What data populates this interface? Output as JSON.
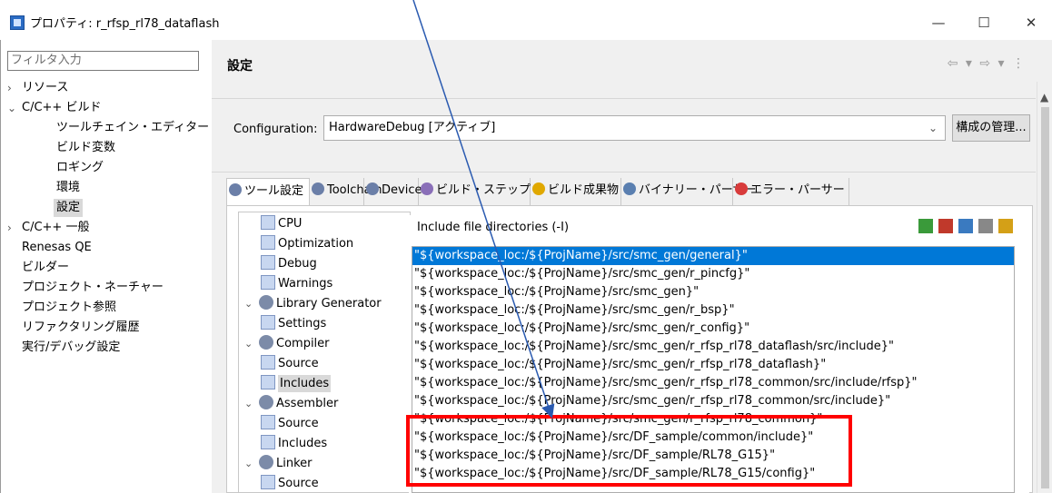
{
  "window": {
    "title": "プロパティ: r_rfsp_rl78_dataflash",
    "minimize": "—",
    "maximize": "☐",
    "close": "✕"
  },
  "sidebar": {
    "filter_placeholder": "フィルタ入力",
    "items": [
      {
        "label": "リソース",
        "expander": "›",
        "indent": 0
      },
      {
        "label": "C/C++ ビルド",
        "expander": "⌄",
        "indent": 0
      },
      {
        "label": "ツールチェイン・エディター",
        "expander": "",
        "indent": 1
      },
      {
        "label": "ビルド変数",
        "expander": "",
        "indent": 1
      },
      {
        "label": "ロギング",
        "expander": "",
        "indent": 1
      },
      {
        "label": "環境",
        "expander": "",
        "indent": 1
      },
      {
        "label": "設定",
        "expander": "",
        "indent": 1,
        "selected": true
      },
      {
        "label": "C/C++ 一般",
        "expander": "›",
        "indent": 0
      },
      {
        "label": "Renesas QE",
        "expander": "",
        "indent": 0
      },
      {
        "label": "ビルダー",
        "expander": "",
        "indent": 0
      },
      {
        "label": "プロジェクト・ネーチャー",
        "expander": "",
        "indent": 0
      },
      {
        "label": "プロジェクト参照",
        "expander": "",
        "indent": 0
      },
      {
        "label": "リファクタリング履歴",
        "expander": "",
        "indent": 0
      },
      {
        "label": "実行/デバッグ設定",
        "expander": "",
        "indent": 0
      }
    ]
  },
  "header": {
    "title": "設定",
    "nav": "⇦ ▾ ⇨ ▾ ⋮"
  },
  "configuration": {
    "label": "Configuration:",
    "value": "HardwareDebug  [アクティブ]",
    "manage_button": "構成の管理..."
  },
  "tabs": [
    {
      "label": "ツール設定",
      "icon": "gear-icon",
      "color": "#6b7fa8",
      "active": true
    },
    {
      "label": "Toolchain",
      "icon": "gear-icon",
      "color": "#6b7fa8"
    },
    {
      "label": "Device",
      "icon": "gear-icon",
      "color": "#6b7fa8"
    },
    {
      "label": "ビルド・ステップ",
      "icon": "wand-icon",
      "color": "#8a6fb8"
    },
    {
      "label": "ビルド成果物",
      "icon": "trophy-icon",
      "color": "#e0a800"
    },
    {
      "label": "バイナリー・パーサー",
      "icon": "binary-icon",
      "color": "#5a7fb0"
    },
    {
      "label": "エラー・パーサー",
      "icon": "error-icon",
      "color": "#d83b3b"
    }
  ],
  "tool_tree": [
    {
      "label": "CPU",
      "type": "option",
      "indent": 1
    },
    {
      "label": "Optimization",
      "type": "option",
      "indent": 1
    },
    {
      "label": "Debug",
      "type": "option",
      "indent": 1
    },
    {
      "label": "Warnings",
      "type": "option",
      "indent": 1
    },
    {
      "label": "Library Generator",
      "type": "tool",
      "indent": 0,
      "expanded": true
    },
    {
      "label": "Settings",
      "type": "option",
      "indent": 1
    },
    {
      "label": "Compiler",
      "type": "tool",
      "indent": 0,
      "expanded": true
    },
    {
      "label": "Source",
      "type": "option",
      "indent": 1
    },
    {
      "label": "Includes",
      "type": "option",
      "indent": 1,
      "selected": true
    },
    {
      "label": "Assembler",
      "type": "tool",
      "indent": 0,
      "expanded": true
    },
    {
      "label": "Source",
      "type": "option",
      "indent": 1
    },
    {
      "label": "Includes",
      "type": "option",
      "indent": 1
    },
    {
      "label": "Linker",
      "type": "tool",
      "indent": 0,
      "expanded": true
    },
    {
      "label": "Source",
      "type": "option",
      "indent": 1
    }
  ],
  "includes": {
    "title": "Include file directories (-I)",
    "tools": [
      "add-icon",
      "delete-icon",
      "edit-icon",
      "move-up-icon",
      "move-down-icon"
    ],
    "rows": [
      "\"${workspace_loc:/${ProjName}/src/smc_gen/general}\"",
      "\"${workspace_loc:/${ProjName}/src/smc_gen/r_pincfg}\"",
      "\"${workspace_loc:/${ProjName}/src/smc_gen}\"",
      "\"${workspace_loc:/${ProjName}/src/smc_gen/r_bsp}\"",
      "\"${workspace_loc:/${ProjName}/src/smc_gen/r_config}\"",
      "\"${workspace_loc:/${ProjName}/src/smc_gen/r_rfsp_rl78_dataflash/src/include}\"",
      "\"${workspace_loc:/${ProjName}/src/smc_gen/r_rfsp_rl78_dataflash}\"",
      "\"${workspace_loc:/${ProjName}/src/smc_gen/r_rfsp_rl78_common/src/include/rfsp}\"",
      "\"${workspace_loc:/${ProjName}/src/smc_gen/r_rfsp_rl78_common/src/include}\"",
      "\"${workspace_loc:/${ProjName}/src/smc_gen/r_rfsp_rl78_common}\"",
      "\"${workspace_loc:/${ProjName}/src/DF_sample/common/include}\"",
      "\"${workspace_loc:/${ProjName}/src/DF_sample/RL78_G15}\"",
      "\"${workspace_loc:/${ProjName}/src/DF_sample/RL78_G15/config}\""
    ],
    "selected_index": 0
  },
  "annotation": {
    "highlight_color": "#ff0000",
    "arrow_color": "#2a5ab0"
  }
}
